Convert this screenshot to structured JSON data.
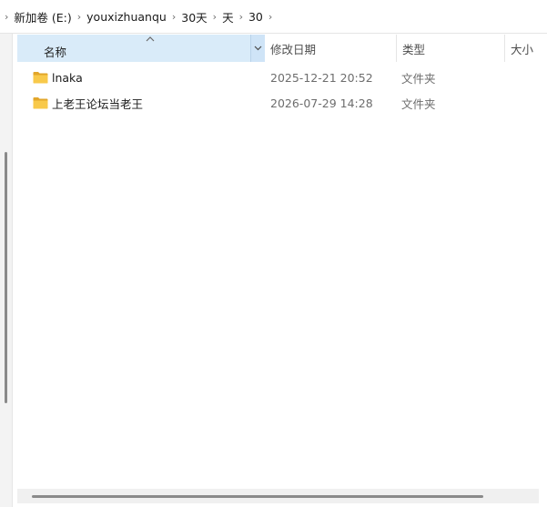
{
  "address_bar": {
    "crumbs": [
      "新加卷 (E:)",
      "youxizhuanqu",
      "30天",
      "天",
      "30"
    ],
    "separator": "›"
  },
  "columns": {
    "name": "名称",
    "date_modified": "修改日期",
    "type": "类型",
    "size": "大小",
    "sorted_by": "name",
    "sort_direction": "ascending"
  },
  "files": [
    {
      "name": "lnaka",
      "date_modified": "2025-12-21 20:52",
      "type": "文件夹",
      "icon": "folder-icon"
    },
    {
      "name": "上老王论坛当老王",
      "date_modified": "2026-07-29 14:28",
      "type": "文件夹",
      "icon": "folder-icon"
    }
  ],
  "colors": {
    "header_selected_bg": "#d9ebf9",
    "folder_yellow": "#f8c94a",
    "folder_dark": "#e2a62a",
    "muted_text": "#6d6d6d",
    "scrollbar_thumb": "#8a8a8a"
  }
}
